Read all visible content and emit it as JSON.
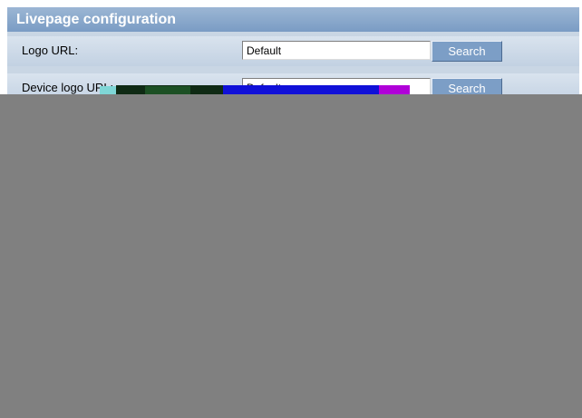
{
  "panel": {
    "title": "Livepage configuration",
    "rows": [
      {
        "label": "Logo URL:",
        "value": "Default",
        "button": "Search"
      },
      {
        "label": "Device logo URL:",
        "value": "Default",
        "button": "Search"
      }
    ]
  },
  "colors": {
    "header": "#7a9cc4",
    "panel_bg": "#c9d6e4",
    "button": "#7c9ec6",
    "corrupted_area": "#808080"
  }
}
